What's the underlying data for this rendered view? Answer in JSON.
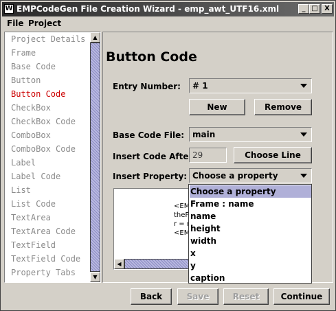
{
  "window": {
    "title": "EMPCodeGen File Creation Wizard - emp_awt_UTF16.xml",
    "app_icon": "W",
    "controls": {
      "minimize": "_",
      "maximize": "□",
      "close": "X"
    }
  },
  "menubar": {
    "items": [
      {
        "label": "File"
      },
      {
        "label": "Project"
      }
    ]
  },
  "sidebar": {
    "items": [
      {
        "label": "Project Details"
      },
      {
        "label": "Frame"
      },
      {
        "label": "Base Code"
      },
      {
        "label": "Button"
      },
      {
        "label": "Button Code",
        "active": true
      },
      {
        "label": "CheckBox"
      },
      {
        "label": "CheckBox Code"
      },
      {
        "label": "ComboBox"
      },
      {
        "label": "ComboBox Code"
      },
      {
        "label": "Label"
      },
      {
        "label": "Label Code"
      },
      {
        "label": "List"
      },
      {
        "label": "List Code"
      },
      {
        "label": "TextArea"
      },
      {
        "label": "TextArea Code"
      },
      {
        "label": "TextField"
      },
      {
        "label": "TextField Code"
      },
      {
        "label": "Property Tabs"
      }
    ]
  },
  "main": {
    "heading": "Button Code",
    "entry_number": {
      "label": "Entry Number:",
      "value": "# 1"
    },
    "new_button": "New",
    "remove_button": "Remove",
    "base_code_file": {
      "label": "Base Code File:",
      "value": "main"
    },
    "insert_code_after": {
      "label": "Insert Code After:",
      "value": "29",
      "button": "Choose Line"
    },
    "insert_property": {
      "label": "Insert Property:",
      "value": "Choose a property"
    },
    "code_lines": [
      "<EM",
      "theF",
      "r = r",
      "<EM"
    ]
  },
  "property_dropdown": {
    "options": [
      "Choose a property",
      "Frame : name",
      "name",
      "height",
      "width",
      "x",
      "y",
      "caption"
    ],
    "selected_index": 0
  },
  "footer": {
    "back": "Back",
    "save": "Save",
    "reset": "Reset",
    "continue": "Continue"
  }
}
